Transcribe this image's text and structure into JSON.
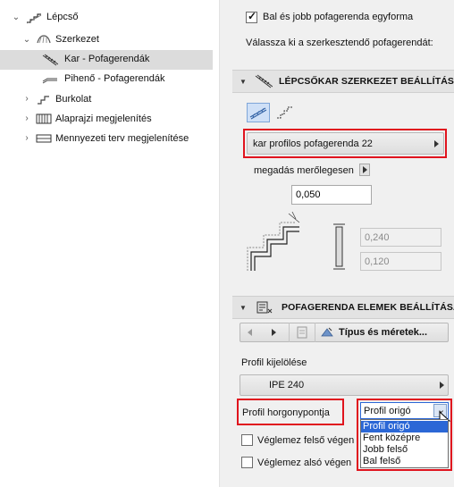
{
  "tree": {
    "items": [
      {
        "label": "Lépcső",
        "icon": "stair-icon",
        "expanded": true
      },
      {
        "label": "Szerkezet",
        "icon": "structure-icon",
        "expanded": true
      },
      {
        "label": "Kar - Pofagerendák",
        "icon": "flight-stringer-icon",
        "selected": true
      },
      {
        "label": "Pihenő - Pofagerendák",
        "icon": "landing-stringer-icon"
      },
      {
        "label": "Burkolat",
        "icon": "finish-icon",
        "expanded": false
      },
      {
        "label": "Alaprajzi megjelenítés",
        "icon": "floor-plan-icon",
        "expanded": false
      },
      {
        "label": "Mennyezeti terv megjelenítése",
        "icon": "ceiling-plan-icon",
        "expanded": false
      }
    ]
  },
  "panel": {
    "same_stringers_label": "Bal és jobb pofagerenda egyforma",
    "same_stringers_checked": true,
    "select_stringer_label": "Válassza ki a szerkesztendő pofagerendát:",
    "section1_title": "LÉPCSŐKAR SZERKEZET BEÁLLÍTÁSAI",
    "profile_button_label": "kar profilos pofagerenda 22",
    "perpendicular_label": "megadás merőlegesen",
    "offset_value": "0,050",
    "height_value": "0,240",
    "width_value": "0,120",
    "section2_title": "POFAGERENDA ELEMEK BEÁLLÍTÁSAI",
    "type_sizes_label": "Típus és méretek...",
    "profile_designation_label": "Profil kijelölése",
    "profile_value": "IPE 240",
    "anchor_label": "Profil horgonypontja",
    "anchor_selected": "Profil origó",
    "anchor_options": [
      "Profil origó",
      "Fent középre",
      "Jobb felső",
      "Bal felső"
    ],
    "finalize_top_label": "Véglemez felső végen",
    "finalize_bottom_label": "Véglemez alsó végen"
  },
  "colors": {
    "highlight_red": "#e0141e",
    "selection_blue": "#2b67d6",
    "tree_selected": "#dcdcdc",
    "panel_bg": "#f0f0f0"
  }
}
